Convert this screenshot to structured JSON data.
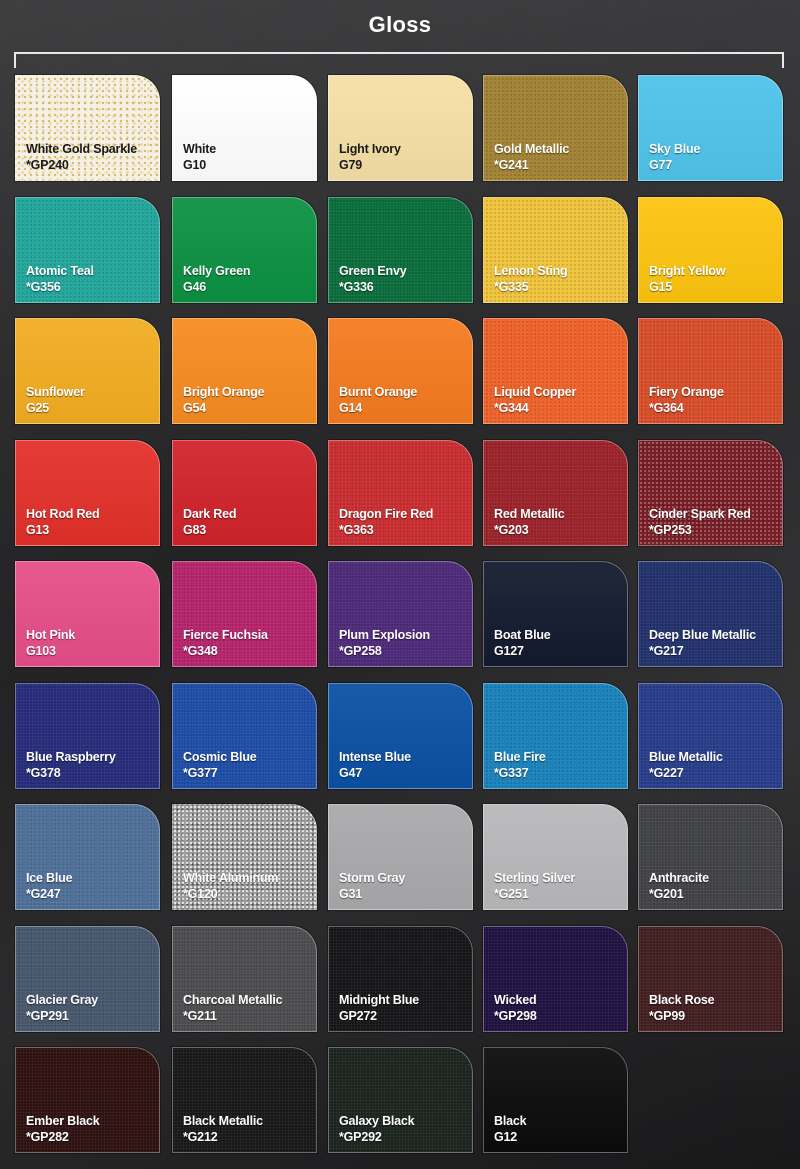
{
  "title": "Gloss",
  "swatches": [
    {
      "name": "White Gold Sparkle",
      "code": "*GP240",
      "color": "#f5f0e4",
      "tone": "light",
      "texture": "sparkle-gold"
    },
    {
      "name": "White",
      "code": "G10",
      "color": "#ffffff",
      "tone": "light",
      "texture": "none"
    },
    {
      "name": "Light Ivory",
      "code": "G79",
      "color": "#f5dfa6",
      "tone": "light",
      "texture": "none"
    },
    {
      "name": "Gold Metallic",
      "code": "*G241",
      "color": "#a08030",
      "tone": "dark",
      "texture": "metallic"
    },
    {
      "name": "Sky Blue",
      "code": "G77",
      "color": "#4ec3ea",
      "tone": "dark",
      "texture": "none"
    },
    {
      "name": "Atomic Teal",
      "code": "*G356",
      "color": "#1ea59a",
      "tone": "dark",
      "texture": "metallic"
    },
    {
      "name": "Kelly Green",
      "code": "G46",
      "color": "#0c9142",
      "tone": "dark",
      "texture": "none"
    },
    {
      "name": "Green Envy",
      "code": "*G336",
      "color": "#066b38",
      "tone": "dark",
      "texture": "metallic"
    },
    {
      "name": "Lemon Sting",
      "code": "*G335",
      "color": "#efc237",
      "tone": "dark",
      "texture": "metallic"
    },
    {
      "name": "Bright Yellow",
      "code": "G15",
      "color": "#fcc410",
      "tone": "dark",
      "texture": "none"
    },
    {
      "name": "Sunflower",
      "code": "G25",
      "color": "#f1ac21",
      "tone": "dark",
      "texture": "none"
    },
    {
      "name": "Bright Orange",
      "code": "G54",
      "color": "#f68b21",
      "tone": "dark",
      "texture": "none"
    },
    {
      "name": "Burnt Orange",
      "code": "G14",
      "color": "#f47a20",
      "tone": "dark",
      "texture": "none"
    },
    {
      "name": "Liquid Copper",
      "code": "*G344",
      "color": "#ee5f26",
      "tone": "dark",
      "texture": "metallic"
    },
    {
      "name": "Fiery Orange",
      "code": "*G364",
      "color": "#d84a25",
      "tone": "dark",
      "texture": "metallic"
    },
    {
      "name": "Hot Rod Red",
      "code": "G13",
      "color": "#e2302a",
      "tone": "dark",
      "texture": "none"
    },
    {
      "name": "Dark Red",
      "code": "G83",
      "color": "#d0232b",
      "tone": "dark",
      "texture": "none"
    },
    {
      "name": "Dragon Fire Red",
      "code": "*G363",
      "color": "#c92a2c",
      "tone": "dark",
      "texture": "metallic"
    },
    {
      "name": "Red Metallic",
      "code": "*G203",
      "color": "#9a1f26",
      "tone": "dark",
      "texture": "metallic"
    },
    {
      "name": "Cinder Spark Red",
      "code": "*GP253",
      "color": "#7a1e27",
      "tone": "dark",
      "texture": "sparkle"
    },
    {
      "name": "Hot Pink",
      "code": "G103",
      "color": "#e54e88",
      "tone": "dark",
      "texture": "none"
    },
    {
      "name": "Fierce Fuchsia",
      "code": "*G348",
      "color": "#b5206a",
      "tone": "dark",
      "texture": "metallic"
    },
    {
      "name": "Plum Explosion",
      "code": "*GP258",
      "color": "#4b2677",
      "tone": "dark",
      "texture": "metallic"
    },
    {
      "name": "Boat Blue",
      "code": "G127",
      "color": "#131a2e",
      "tone": "dark",
      "texture": "none"
    },
    {
      "name": "Deep Blue Metallic",
      "code": "*G217",
      "color": "#1e2e6a",
      "tone": "dark",
      "texture": "metallic"
    },
    {
      "name": "Blue Raspberry",
      "code": "*G378",
      "color": "#222878",
      "tone": "dark",
      "texture": "metallic"
    },
    {
      "name": "Cosmic Blue",
      "code": "*G377",
      "color": "#1a4aa6",
      "tone": "dark",
      "texture": "metallic"
    },
    {
      "name": "Intense Blue",
      "code": "G47",
      "color": "#0b50a3",
      "tone": "dark",
      "texture": "none"
    },
    {
      "name": "Blue Fire",
      "code": "*G337",
      "color": "#1680b9",
      "tone": "dark",
      "texture": "metallic"
    },
    {
      "name": "Blue Metallic",
      "code": "*G227",
      "color": "#223a88",
      "tone": "dark",
      "texture": "metallic"
    },
    {
      "name": "Ice Blue",
      "code": "*G247",
      "color": "#4c6d97",
      "tone": "dark",
      "texture": "metallic"
    },
    {
      "name": "White Aluminum",
      "code": "*G120",
      "color": "#9a9a9a",
      "tone": "dark",
      "texture": "sparkle-silver"
    },
    {
      "name": "Storm Gray",
      "code": "G31",
      "color": "#a9a9ab",
      "tone": "dark",
      "texture": "none"
    },
    {
      "name": "Sterling Silver",
      "code": "*G251",
      "color": "#b8b8ba",
      "tone": "dark",
      "texture": "none"
    },
    {
      "name": "Anthracite",
      "code": "*G201",
      "color": "#3e3f42",
      "tone": "dark",
      "texture": "metallic"
    },
    {
      "name": "Glacier Gray",
      "code": "*GP291",
      "color": "#44546a",
      "tone": "dark",
      "texture": "metallic"
    },
    {
      "name": "Charcoal Metallic",
      "code": "*G211",
      "color": "#4a4a4c",
      "tone": "dark",
      "texture": "metallic"
    },
    {
      "name": "Midnight Blue",
      "code": "GP272",
      "color": "#121214",
      "tone": "dark",
      "texture": "metallic"
    },
    {
      "name": "Wicked",
      "code": "*GP298",
      "color": "#1c0d3e",
      "tone": "dark",
      "texture": "metallic"
    },
    {
      "name": "Black Rose",
      "code": "*GP99",
      "color": "#3f1a1c",
      "tone": "dark",
      "texture": "metallic"
    },
    {
      "name": "Ember Black",
      "code": "*GP282",
      "color": "#2a0d0c",
      "tone": "dark",
      "texture": "metallic"
    },
    {
      "name": "Black Metallic",
      "code": "*G212",
      "color": "#141414",
      "tone": "dark",
      "texture": "metallic"
    },
    {
      "name": "Galaxy Black",
      "code": "*GP292",
      "color": "#17201a",
      "tone": "dark",
      "texture": "metallic"
    },
    {
      "name": "Black",
      "code": "G12",
      "color": "#0b0b0b",
      "tone": "dark",
      "texture": "none"
    }
  ]
}
